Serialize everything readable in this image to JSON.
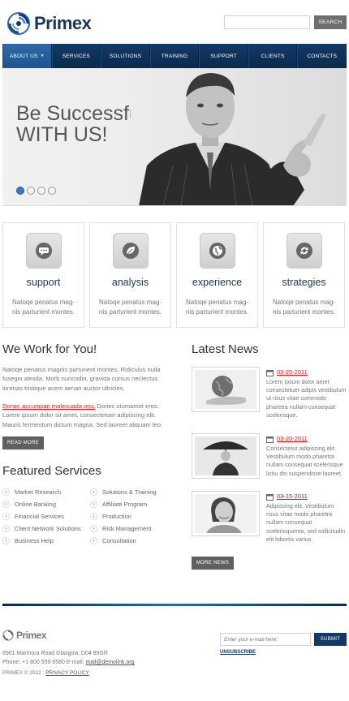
{
  "header": {
    "logo_text": "Primex",
    "search_placeholder": "",
    "search_button": "SEARCH"
  },
  "nav": {
    "items": [
      {
        "label": "ABOUT US"
      },
      {
        "label": "SERVICES"
      },
      {
        "label": "SOLUTIONS"
      },
      {
        "label": "TRAINING"
      },
      {
        "label": "SUPPORT"
      },
      {
        "label": "CLIENTS"
      },
      {
        "label": "CONTACTS"
      }
    ],
    "active_index": 0
  },
  "hero": {
    "title_line1": "Be Successful",
    "title_line2": "WITH US!",
    "slides": 4,
    "active_slide": 1
  },
  "features": [
    {
      "icon": "chat-bubble-icon",
      "title": "support",
      "text": "Natoqe penatus mag-nis parturient montes."
    },
    {
      "icon": "leaf-icon",
      "title": "analysis",
      "text": "Natoqe penatus mag-nis parturient montes."
    },
    {
      "icon": "globe-icon",
      "title": "experience",
      "text": "Natoqe penatus mag-nis parturient montes."
    },
    {
      "icon": "strategy-icon",
      "title": "strategies",
      "text": "Natoqe penatus mag-nis parturient montes."
    }
  ],
  "we_work": {
    "heading": "We Work for You!",
    "para1": "Natoqe penatus magnis parturient montes. Ridiculus nulla fusegin alesda. Morb nuncodio, gravida cursus neclectus lorenas tristique acem aenan auctor ultricies.",
    "link_text": "Donec accumsan malesuada orci.",
    "para2_rest": " Donec stumamet eros. Lorem ipsum dolor sit amet, consectetuer adipiscing elit. Mauris fermentum dictum magna. Sed laoreet aliquam leo.",
    "button": "READ MORE"
  },
  "featured_services": {
    "heading": "Featured Services",
    "col1": [
      "Market Research",
      "Online Banking",
      "Financial Services",
      "Client Network Solutions",
      "Business Help"
    ],
    "col2": [
      "Solutions & Training",
      "Affiliate Program",
      "Production",
      "Risk Management",
      "Consultation"
    ]
  },
  "news": {
    "heading": "Latest News",
    "items": [
      {
        "date": "03-25-2011",
        "text": "Lorem ipsum dolor amet consectetuer adipis vestibulum ut risus vitae commodo pharetra nullam consequat scelerisque."
      },
      {
        "date": "03-20-2011",
        "text": "Consectetur adipiscing elit. Vestibulum modo pharetra nullam consequat scelerisque licitu din suspendisse laoreet."
      },
      {
        "date": "03-15-2011",
        "text": "Adipiscing elit. Vestibulum risus vitae modo pharetra nullam consequat scelerisquenta, sed sollicitudin elit lobortis varius."
      }
    ],
    "button": "MORE NEWS"
  },
  "footer": {
    "logo_text": "Primex",
    "address": "8901 Marmora Road Glasgow, D04 89GR",
    "phone_line": "Phone: +1 800 559 6580  E-mail:",
    "email": "mail@demolink.org",
    "copyright": "PRIMEX © 2012 :",
    "privacy": "PRIVACY POLICY",
    "newsletter_placeholder": "Enter your e-mail here:",
    "subscribe": "SUBMIT",
    "unsubscribe": "UNSUBSCRIBE"
  },
  "colors": {
    "nav_bg": "#0c2a4d",
    "accent_blue": "#2d6aa8",
    "accent_red": "#d02020",
    "dark_button": "#5f5f5f"
  }
}
